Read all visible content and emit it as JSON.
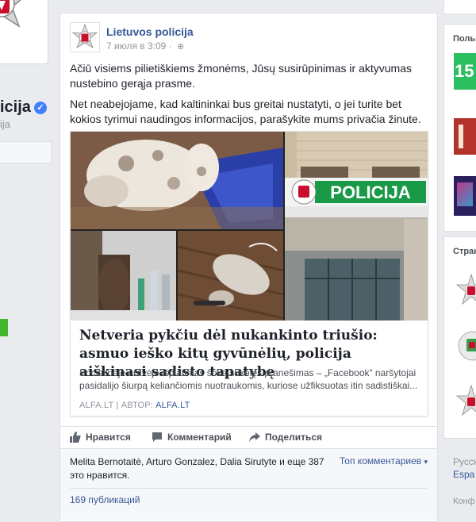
{
  "left": {
    "page_name": "icija",
    "handle": "ija"
  },
  "post": {
    "author": "Lietuvos policija",
    "timestamp": "7 июля в 3:09 ·",
    "paragraphs": [
      "Ačiū visiems pilietiškiems žmonėms, Jūsų susirūpinimas ir aktyvumas nustebino gerąja prasme.",
      "Net neabejojame, kad kaltininkai bus greitai nustatyti, o jei turite bet kokios tyrimui naudingos informacijos, parašykite mums privačia žinute."
    ],
    "link": {
      "police_sign": "POLICIJA",
      "title": "Netveria pykčiu dėl nukankinto triušio: asmuo ieško kitų gyvūnėlių, policija aiškinasi sadisto tapatybę",
      "description": "Socialinėje erdvėje išplatintas šoką sukėlęs pranešimas – „Facebook“ naršytojai pasidalijo šiurpą keliančiomis nuotraukomis, kuriose užfiksuotas itin sadistiškai...",
      "source": "ALFA.LT",
      "author_label": "АВТОР:",
      "author": "ALFA.LT"
    },
    "actions": {
      "like": "Нравится",
      "comment": "Комментарий",
      "share": "Поделиться"
    },
    "likes_text": "Melita Bernotaitė, Arturo Gonzalez, Dalia Sirutyte и еще 387 это нравится.",
    "top_comments": "Топ комментариев",
    "shares": "169 публикаций"
  },
  "right": {
    "section1_header": "Польз",
    "section2_header": "Стран",
    "footer_lang": "Русск",
    "footer_lang2": "Espa",
    "footer_conf": "Конф",
    "badge_15": "15"
  },
  "colors": {
    "link_blue": "#365899",
    "fb_bg": "#e9ebee",
    "police_green": "#1a9a47"
  }
}
